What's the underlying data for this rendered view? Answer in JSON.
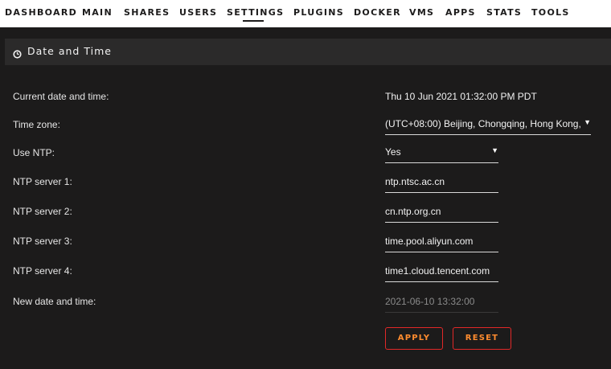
{
  "nav": {
    "items": [
      {
        "label": "DASHBOARD"
      },
      {
        "label": "MAIN"
      },
      {
        "label": "SHARES"
      },
      {
        "label": "USERS"
      },
      {
        "label": "SETTINGS"
      },
      {
        "label": "PLUGINS"
      },
      {
        "label": "DOCKER"
      },
      {
        "label": "VMS"
      },
      {
        "label": "APPS"
      },
      {
        "label": "STATS"
      },
      {
        "label": "TOOLS"
      }
    ],
    "active": "SETTINGS"
  },
  "panel": {
    "icon": "clock-icon",
    "title": "Date and Time"
  },
  "form": {
    "current_label": "Current date and time:",
    "current_value": "Thu 10 Jun 2021 01:32:00 PM PDT",
    "timezone_label": "Time zone:",
    "timezone_value": "(UTC+08:00) Beijing, Chongqing, Hong Kong,",
    "use_ntp_label": "Use NTP:",
    "use_ntp_value": "Yes",
    "ntp1_label": "NTP server 1:",
    "ntp1_value": "ntp.ntsc.ac.cn",
    "ntp2_label": "NTP server 2:",
    "ntp2_value": "cn.ntp.org.cn",
    "ntp3_label": "NTP server 3:",
    "ntp3_value": "time.pool.aliyun.com",
    "ntp4_label": "NTP server 4:",
    "ntp4_value": "time1.cloud.tencent.com",
    "new_datetime_label": "New date and time:",
    "new_datetime_value": "2021-06-10 13:32:00"
  },
  "buttons": {
    "apply": "APPLY",
    "reset": "RESET"
  },
  "colors": {
    "background": "#1c1b1b",
    "nav_background": "#ffffff",
    "panel_header": "#2b2a2a",
    "button_border": "#e22828",
    "button_text": "#ff8c2f"
  }
}
